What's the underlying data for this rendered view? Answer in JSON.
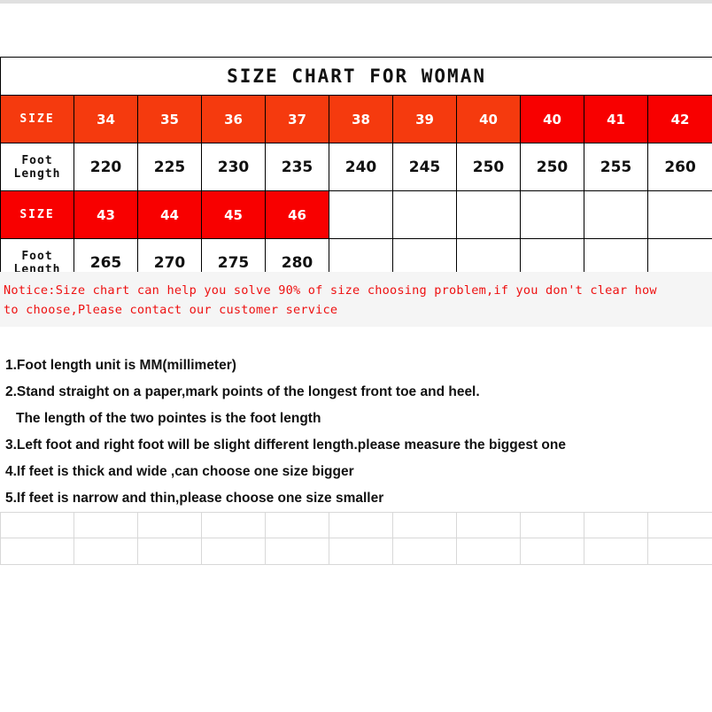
{
  "title": "SIZE CHART FOR WOMAN",
  "table": {
    "row_label_size": "SIZE",
    "row_label_foot_length": "Foot Length",
    "row1_sizes": [
      "34",
      "35",
      "36",
      "37",
      "38",
      "39",
      "40",
      "40",
      "41",
      "42"
    ],
    "row1_foot_lengths": [
      "220",
      "225",
      "230",
      "235",
      "240",
      "245",
      "250",
      "250",
      "255",
      "260"
    ],
    "row2_sizes": [
      "43",
      "44",
      "45",
      "46"
    ],
    "row2_foot_lengths": [
      "265",
      "270",
      "275",
      "280"
    ],
    "colors": {
      "header_orange": "#f53a0e",
      "header_red": "#f80000",
      "header_text": "#ffffff",
      "cell_text": "#111111",
      "border": "#000000"
    }
  },
  "notice": {
    "line1": "Notice:Size chart can help you solve 90% of size choosing problem,if you don't clear how",
    "line2": "to choose,Please contact our customer service",
    "color": "#ee1111",
    "background": "#f5f5f5"
  },
  "instructions": [
    "1.Foot length unit is MM(millimeter)",
    "2.Stand straight on a paper,mark points of the longest front toe and heel.",
    "The length of the two pointes is the foot length",
    "3.Left foot and right foot will be slight different length.please measure the biggest one",
    "4.If feet is thick and wide ,can choose one size bigger",
    "5.If feet is narrow and thin,please choose one size smaller"
  ],
  "bottom_grid": {
    "rows": 2,
    "columns": 11,
    "border_color": "#d8d8d8"
  }
}
